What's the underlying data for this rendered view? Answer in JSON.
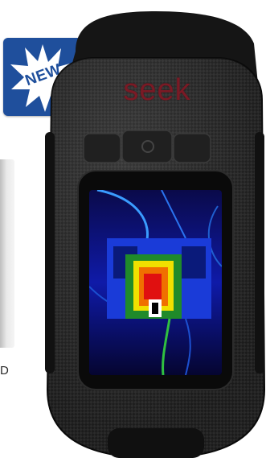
{
  "badge": {
    "text": "NEW",
    "color": "#1f4f9c"
  },
  "device": {
    "brand": "seek",
    "brand_color": "#7a1a25",
    "body_color": "#1c1c1c"
  },
  "side": {
    "text": "D"
  },
  "icons": [
    "burst-icon",
    "power-icon"
  ]
}
